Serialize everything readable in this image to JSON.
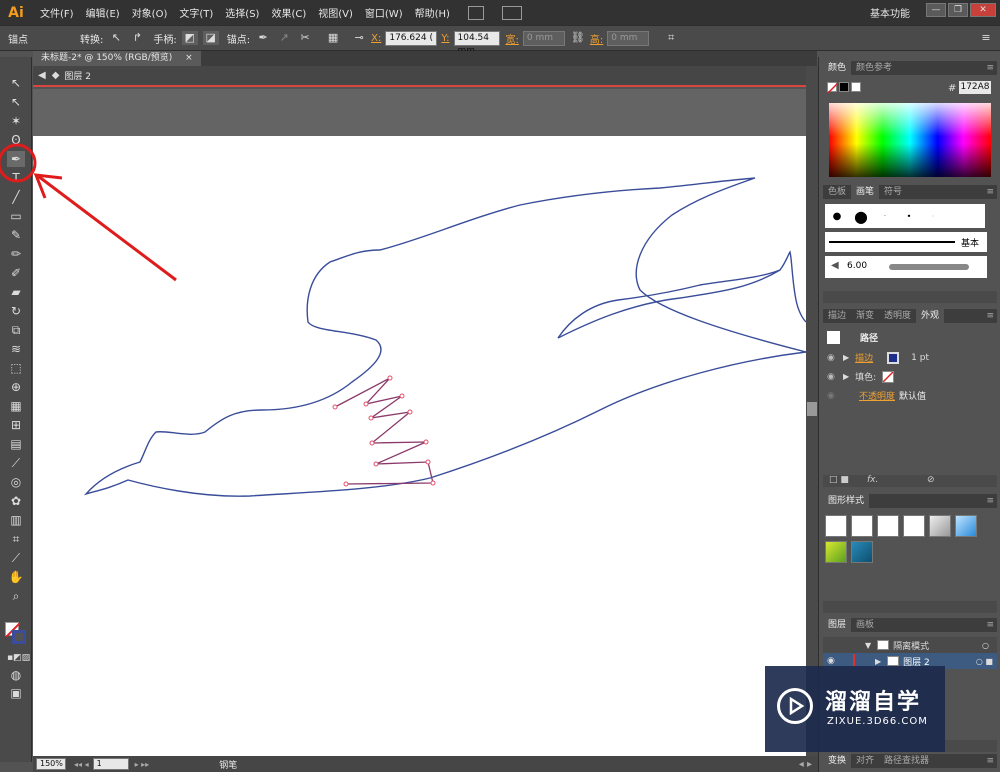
{
  "app": {
    "logo": "Ai"
  },
  "menu": [
    "文件(F)",
    "编辑(E)",
    "对象(O)",
    "文字(T)",
    "选择(S)",
    "效果(C)",
    "视图(V)",
    "窗口(W)",
    "帮助(H)"
  ],
  "workspace": "基本功能",
  "window_buttons": [
    "—",
    "❐",
    "✕"
  ],
  "control": {
    "anchor_label": "锚点",
    "convert_label": "转换:",
    "handles_label": "手柄:",
    "anchor_points_label": "锚点:",
    "x_label": "X:",
    "x_value": "176.624 (",
    "y_label": "Y:",
    "y_value": "104.54 mm",
    "w_label": "宽:",
    "w_value": "0 mm",
    "h_label": "高:",
    "h_value": "0 mm"
  },
  "document": {
    "tab_title": "未标题-2* @ 150% (RGB/预览)",
    "tab_close": "×",
    "layer_crumb": "图层 2"
  },
  "status": {
    "zoom": "150%",
    "page": "1",
    "tool": "钢笔"
  },
  "colors": {
    "outline": "#3a4d9a",
    "zigzag": "#8a3a6a",
    "anchor": "#e0506a",
    "annotation": "#e01b1b",
    "accent": "#f0a030"
  },
  "panels": {
    "color": {
      "tabs": [
        "颜色",
        "颜色参考"
      ],
      "hash": "#",
      "hex": "172A8"
    },
    "brush": {
      "tabs": [
        "色板",
        "画笔",
        "符号"
      ],
      "basic_label": "基本",
      "size": "6.00"
    },
    "appearance": {
      "tabs": [
        "描边",
        "渐变",
        "透明度",
        "外观"
      ],
      "path_label": "路径",
      "stroke_label": "描边",
      "stroke_weight": "1 pt",
      "fill_label": "填色:",
      "opacity_label": "不透明度",
      "opacity_value": "默认值"
    },
    "graphic_styles": {
      "tabs": [
        "图形样式"
      ]
    },
    "layers": {
      "tabs": [
        "图层",
        "画板"
      ],
      "isolation": "隔离模式",
      "layer_name": "图层 2"
    },
    "bottom": {
      "tabs": [
        "变换",
        "对齐",
        "路径查找器"
      ]
    }
  },
  "watermark": {
    "title": "溜溜自学",
    "subtitle": "ZIXUE.3D66.COM"
  }
}
